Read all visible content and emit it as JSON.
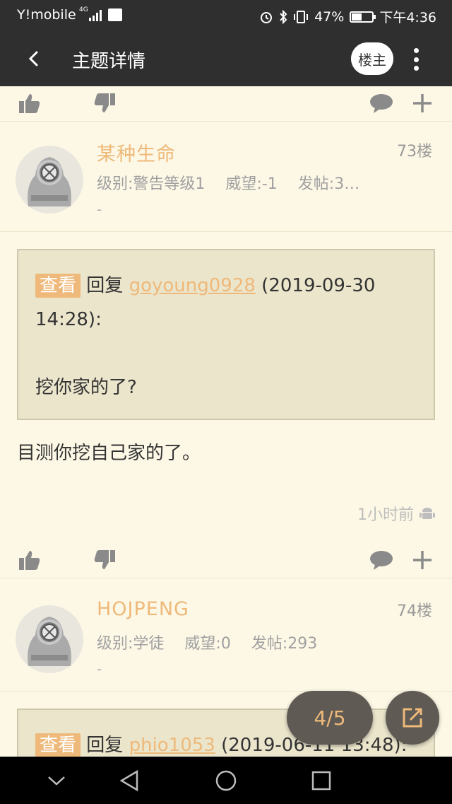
{
  "status_bar": {
    "carrier": "Y!mobile",
    "signal_label": "4G",
    "battery": "47%",
    "time": "下午4:36"
  },
  "app_bar": {
    "title": "主题详情",
    "op_button": "楼主"
  },
  "posts": [
    {
      "username": "某种生命",
      "floor": "73楼",
      "level": "级别:警告等级1",
      "prestige": "威望:-1",
      "posts": "发帖:3…",
      "signature": "-",
      "quote_tag": "查看",
      "quote_reply": "回复",
      "quote_user": "goyoung0928",
      "quote_time": "(2019-09-30 14:28):",
      "quote_text": "挖你家的了?",
      "body": "目测你挖自己家的了。",
      "time": "1小时前"
    },
    {
      "username": "HOJPENG",
      "floor": "74楼",
      "level": "级别:学徒",
      "prestige": "威望:0",
      "posts": "发帖:293",
      "signature": "-",
      "quote_tag": "查看",
      "quote_reply": "回复",
      "quote_user": "phio1053",
      "quote_time": "(2019-06-11 13:48):"
    }
  ],
  "page_indicator": "4/5",
  "colors": {
    "accent": "#eeb97a",
    "background": "#fdf8e6",
    "bar": "#2f2f2f",
    "quote_bg": "#ebe5cc"
  }
}
